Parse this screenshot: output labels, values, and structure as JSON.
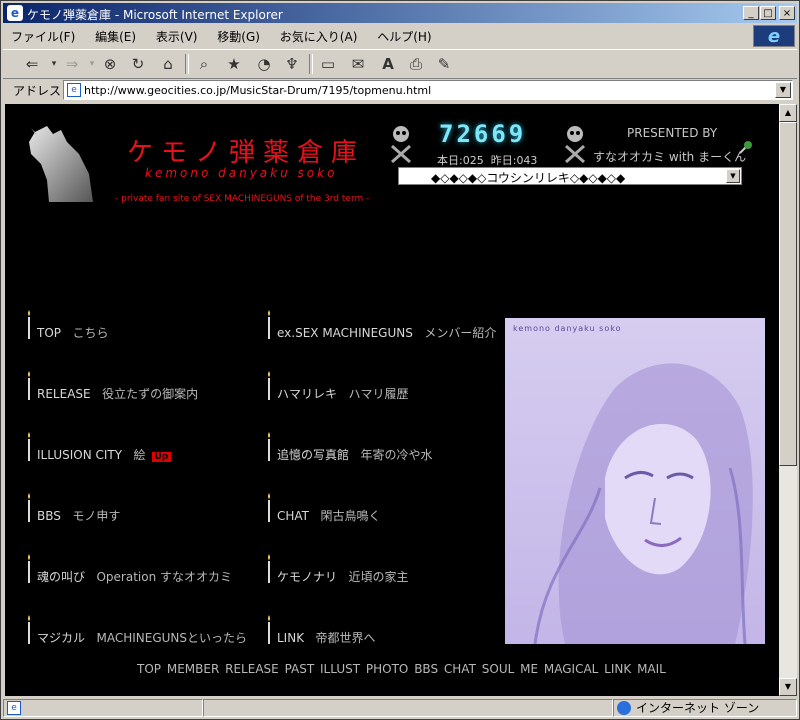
{
  "window": {
    "title": "ケモノ弾薬倉庫 - Microsoft Internet Explorer",
    "controls": [
      "_",
      "□",
      "×"
    ]
  },
  "menubar": [
    "ファイル(F)",
    "編集(E)",
    "表示(V)",
    "移動(G)",
    "お気に入り(A)",
    "ヘルプ(H)"
  ],
  "toolbar": {
    "icons": [
      "back-icon",
      "forward-icon",
      "stop-icon",
      "refresh-icon",
      "home-icon",
      "search-icon",
      "favorites-icon",
      "history-icon",
      "channels-icon",
      "fullscreen-icon",
      "mail-icon",
      "font-icon",
      "print-icon",
      "edit-icon"
    ]
  },
  "address": {
    "label": "アドレス",
    "url": "http://www.geocities.co.jp/MusicStar-Drum/7195/topmenu.html"
  },
  "page": {
    "logo_jp": "ケモノ弾薬倉庫",
    "logo_romaji": "kemono danyaku soko",
    "logo_sub": "- private fan site of SEX MACHINEGUNS of the 3rd term -",
    "counter": "72669",
    "today_label": "本日",
    "today_value": "025",
    "yesterday_label": "昨日",
    "yesterday_value": "043",
    "presented_by": "PRESENTED BY",
    "authors": "すなオオカミ with まーくん",
    "update_select": "◆◇◆◇◆◇コウシンリレキ◇◆◇◆◇◆",
    "portrait_caption": "kemono danyaku soko"
  },
  "nav_left": [
    {
      "title": "TOP",
      "desc": "こちら"
    },
    {
      "title": "RELEASE",
      "desc": "役立たずの御案内"
    },
    {
      "title": "ILLUSION CITY",
      "desc": "絵",
      "badge": "Up"
    },
    {
      "title": "BBS",
      "desc": "モノ申す"
    },
    {
      "title": "魂の叫び",
      "desc": "Operation すなオオカミ"
    },
    {
      "title": "マジカル",
      "desc": "MACHINEGUNSといったら"
    }
  ],
  "nav_right": [
    {
      "title": "ex.SEX MACHINEGUNS",
      "desc": "メンバー紹介"
    },
    {
      "title": "ハマリレキ",
      "desc": "ハマリ履歴"
    },
    {
      "title": "追憶の写真館",
      "desc": "年寄の冷や水"
    },
    {
      "title": "CHAT",
      "desc": "閑古鳥鳴く"
    },
    {
      "title": "ケモノナリ",
      "desc": "近頃の家主"
    },
    {
      "title": "LINK",
      "desc": "帝都世界へ"
    }
  ],
  "footer_links": [
    "TOP",
    "MEMBER",
    "RELEASE",
    "PAST",
    "ILLUST",
    "PHOTO",
    "BBS",
    "CHAT",
    "SOUL",
    "ME",
    "MAGICAL",
    "LINK",
    "MAIL"
  ],
  "status": {
    "zone": "インターネット ゾーン"
  },
  "colors": {
    "logo": "#e8101a",
    "counter": "#7fe8f8",
    "page_bg": "#000000",
    "portrait": "#c9bdea",
    "title_bar": "#0a246a"
  }
}
